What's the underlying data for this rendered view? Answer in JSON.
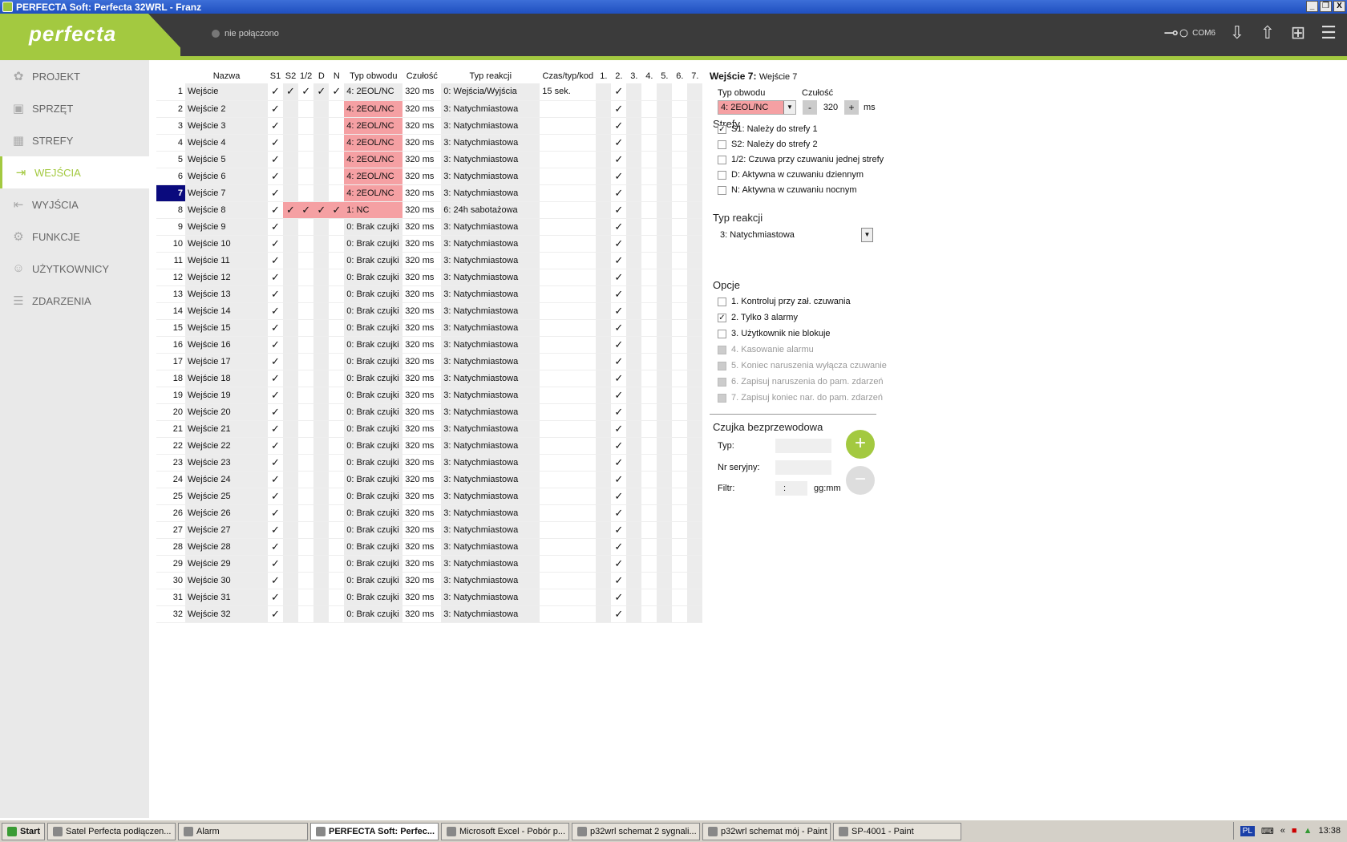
{
  "window": {
    "title": "PERFECTA Soft: Perfecta 32WRL - Franz",
    "buttons": [
      "_",
      "❐",
      "X"
    ]
  },
  "header": {
    "logo": "perfecta",
    "connection_status": "nie połączono",
    "port": "COM6"
  },
  "sidebar": {
    "items": [
      {
        "label": "PROJEKT",
        "icon": "project-icon",
        "active": false
      },
      {
        "label": "SPRZĘT",
        "icon": "chip-icon",
        "active": false
      },
      {
        "label": "STREFY",
        "icon": "zones-icon",
        "active": false
      },
      {
        "label": "WEJŚCIA",
        "icon": "input-icon",
        "active": true
      },
      {
        "label": "WYJŚCIA",
        "icon": "output-icon",
        "active": false
      },
      {
        "label": "FUNKCJE",
        "icon": "gear-icon",
        "active": false
      },
      {
        "label": "UŻYTKOWNICY",
        "icon": "user-icon",
        "active": false
      },
      {
        "label": "ZDARZENIA",
        "icon": "log-icon",
        "active": false
      }
    ]
  },
  "grid": {
    "columns": [
      "Nazwa",
      "S1",
      "S2",
      "1/2",
      "D",
      "N",
      "Typ obwodu",
      "Czułość",
      "Typ reakcji",
      "Czas/typ/kod",
      "1.",
      "2.",
      "3.",
      "4.",
      "5.",
      "6.",
      "7."
    ],
    "check_mark": "✓",
    "rows": [
      {
        "n": "1",
        "name": "Wejście",
        "s1": true,
        "s2": true,
        "half": true,
        "d": true,
        "night": true,
        "typ": "4: 2EOL/NC",
        "czu": "320 ms",
        "rk": "0: Wejścia/Wyjścia",
        "czas": "15 sek.",
        "sel": false,
        "pink": false
      },
      {
        "n": "2",
        "name": "Wejście  2",
        "s1": true,
        "typ": "4: 2EOL/NC",
        "czu": "320 ms",
        "rk": "3: Natychmiastowa",
        "czas": "",
        "pink": true
      },
      {
        "n": "3",
        "name": "Wejście  3",
        "s1": true,
        "typ": "4: 2EOL/NC",
        "czu": "320 ms",
        "rk": "3: Natychmiastowa",
        "czas": "",
        "pink": true
      },
      {
        "n": "4",
        "name": "Wejście  4",
        "s1": true,
        "typ": "4: 2EOL/NC",
        "czu": "320 ms",
        "rk": "3: Natychmiastowa",
        "czas": "",
        "pink": true
      },
      {
        "n": "5",
        "name": "Wejście  5",
        "s1": true,
        "typ": "4: 2EOL/NC",
        "czu": "320 ms",
        "rk": "3: Natychmiastowa",
        "czas": "",
        "pink": true
      },
      {
        "n": "6",
        "name": "Wejście  6",
        "s1": true,
        "typ": "4: 2EOL/NC",
        "czu": "320 ms",
        "rk": "3: Natychmiastowa",
        "czas": "",
        "pink": true
      },
      {
        "n": "7",
        "name": "Wejście  7",
        "s1": true,
        "typ": "4: 2EOL/NC",
        "czu": "320 ms",
        "rk": "3: Natychmiastowa",
        "czas": "",
        "pink": true,
        "sel": true
      },
      {
        "n": "8",
        "name": "Wejście  8",
        "s1": true,
        "s2": true,
        "half": true,
        "d": true,
        "night": true,
        "typ": "1: NC",
        "czu": "320 ms",
        "rk": "6: 24h sabotażowa",
        "czas": "",
        "pink": true,
        "pinkchecks": true
      },
      {
        "n": "9",
        "name": "Wejście  9",
        "s1": true,
        "typ": "0: Brak czujki",
        "czu": "320 ms",
        "rk": "3: Natychmiastowa",
        "czas": ""
      },
      {
        "n": "10",
        "name": "Wejście 10",
        "s1": true,
        "typ": "0: Brak czujki",
        "czu": "320 ms",
        "rk": "3: Natychmiastowa",
        "czas": ""
      },
      {
        "n": "11",
        "name": "Wejście 11",
        "s1": true,
        "typ": "0: Brak czujki",
        "czu": "320 ms",
        "rk": "3: Natychmiastowa",
        "czas": ""
      },
      {
        "n": "12",
        "name": "Wejście 12",
        "s1": true,
        "typ": "0: Brak czujki",
        "czu": "320 ms",
        "rk": "3: Natychmiastowa",
        "czas": ""
      },
      {
        "n": "13",
        "name": "Wejście 13",
        "s1": true,
        "typ": "0: Brak czujki",
        "czu": "320 ms",
        "rk": "3: Natychmiastowa",
        "czas": ""
      },
      {
        "n": "14",
        "name": "Wejście 14",
        "s1": true,
        "typ": "0: Brak czujki",
        "czu": "320 ms",
        "rk": "3: Natychmiastowa",
        "czas": ""
      },
      {
        "n": "15",
        "name": "Wejście 15",
        "s1": true,
        "typ": "0: Brak czujki",
        "czu": "320 ms",
        "rk": "3: Natychmiastowa",
        "czas": ""
      },
      {
        "n": "16",
        "name": "Wejście 16",
        "s1": true,
        "typ": "0: Brak czujki",
        "czu": "320 ms",
        "rk": "3: Natychmiastowa",
        "czas": ""
      },
      {
        "n": "17",
        "name": "Wejście 17",
        "s1": true,
        "typ": "0: Brak czujki",
        "czu": "320 ms",
        "rk": "3: Natychmiastowa",
        "czas": ""
      },
      {
        "n": "18",
        "name": "Wejście 18",
        "s1": true,
        "typ": "0: Brak czujki",
        "czu": "320 ms",
        "rk": "3: Natychmiastowa",
        "czas": ""
      },
      {
        "n": "19",
        "name": "Wejście 19",
        "s1": true,
        "typ": "0: Brak czujki",
        "czu": "320 ms",
        "rk": "3: Natychmiastowa",
        "czas": ""
      },
      {
        "n": "20",
        "name": "Wejście 20",
        "s1": true,
        "typ": "0: Brak czujki",
        "czu": "320 ms",
        "rk": "3: Natychmiastowa",
        "czas": ""
      },
      {
        "n": "21",
        "name": "Wejście 21",
        "s1": true,
        "typ": "0: Brak czujki",
        "czu": "320 ms",
        "rk": "3: Natychmiastowa",
        "czas": ""
      },
      {
        "n": "22",
        "name": "Wejście 22",
        "s1": true,
        "typ": "0: Brak czujki",
        "czu": "320 ms",
        "rk": "3: Natychmiastowa",
        "czas": ""
      },
      {
        "n": "23",
        "name": "Wejście 23",
        "s1": true,
        "typ": "0: Brak czujki",
        "czu": "320 ms",
        "rk": "3: Natychmiastowa",
        "czas": ""
      },
      {
        "n": "24",
        "name": "Wejście 24",
        "s1": true,
        "typ": "0: Brak czujki",
        "czu": "320 ms",
        "rk": "3: Natychmiastowa",
        "czas": ""
      },
      {
        "n": "25",
        "name": "Wejście 25",
        "s1": true,
        "typ": "0: Brak czujki",
        "czu": "320 ms",
        "rk": "3: Natychmiastowa",
        "czas": ""
      },
      {
        "n": "26",
        "name": "Wejście 26",
        "s1": true,
        "typ": "0: Brak czujki",
        "czu": "320 ms",
        "rk": "3: Natychmiastowa",
        "czas": ""
      },
      {
        "n": "27",
        "name": "Wejście 27",
        "s1": true,
        "typ": "0: Brak czujki",
        "czu": "320 ms",
        "rk": "3: Natychmiastowa",
        "czas": ""
      },
      {
        "n": "28",
        "name": "Wejście 28",
        "s1": true,
        "typ": "0: Brak czujki",
        "czu": "320 ms",
        "rk": "3: Natychmiastowa",
        "czas": ""
      },
      {
        "n": "29",
        "name": "Wejście 29",
        "s1": true,
        "typ": "0: Brak czujki",
        "czu": "320 ms",
        "rk": "3: Natychmiastowa",
        "czas": ""
      },
      {
        "n": "30",
        "name": "Wejście 30",
        "s1": true,
        "typ": "0: Brak czujki",
        "czu": "320 ms",
        "rk": "3: Natychmiastowa",
        "czas": ""
      },
      {
        "n": "31",
        "name": "Wejście 31",
        "s1": true,
        "typ": "0: Brak czujki",
        "czu": "320 ms",
        "rk": "3: Natychmiastowa",
        "czas": ""
      },
      {
        "n": "32",
        "name": "Wejście 32",
        "s1": true,
        "typ": "0: Brak czujki",
        "czu": "320 ms",
        "rk": "3: Natychmiastowa",
        "czas": ""
      }
    ]
  },
  "panel": {
    "title": "Wejście 7:",
    "title_name": "Wejście  7",
    "typ_label": "Typ obwodu",
    "typ_value": "4: 2EOL/NC",
    "czulosc_label": "Czułość",
    "czulosc_value": "320",
    "minus": "-",
    "plus": "+",
    "unit": "ms",
    "strefy_label": "Strefy",
    "strefy": [
      {
        "label": "S1: Należy do strefy 1",
        "checked": true
      },
      {
        "label": "S2: Należy do strefy 2",
        "checked": false
      },
      {
        "label": "1/2: Czuwa przy czuwaniu jednej strefy",
        "checked": false
      },
      {
        "label": "D: Aktywna w czuwaniu dziennym",
        "checked": false
      },
      {
        "label": "N: Aktywna w czuwaniu nocnym",
        "checked": false
      }
    ],
    "reakcja_label": "Typ reakcji",
    "reakcja_value": "3: Natychmiastowa",
    "opcje_label": "Opcje",
    "opcje": [
      {
        "label": "1. Kontroluj przy zał. czuwania",
        "checked": false,
        "disabled": false
      },
      {
        "label": "2. Tylko 3 alarmy",
        "checked": true,
        "disabled": false
      },
      {
        "label": "3. Użytkownik nie blokuje",
        "checked": false,
        "disabled": false
      },
      {
        "label": "4. Kasowanie alarmu",
        "checked": false,
        "disabled": true
      },
      {
        "label": "5. Koniec naruszenia wyłącza czuwanie",
        "checked": false,
        "disabled": true
      },
      {
        "label": "6. Zapisuj naruszenia do pam. zdarzeń",
        "checked": false,
        "disabled": true
      },
      {
        "label": "7. Zapisuj koniec nar. do pam. zdarzeń",
        "checked": false,
        "disabled": true
      }
    ],
    "wireless_label": "Czujka bezprzewodowa",
    "typ2_label": "Typ:",
    "serial_label": "Nr seryjny:",
    "filter_label": "Filtr:",
    "filter_value": ":",
    "filter_unit": "gg:mm",
    "add": "+",
    "remove": "−"
  },
  "taskbar": {
    "start": "Start",
    "items": [
      {
        "label": "Satel Perfecta podłączen...",
        "active": false
      },
      {
        "label": "Alarm",
        "active": false
      },
      {
        "label": "PERFECTA Soft: Perfec...",
        "active": true
      },
      {
        "label": "Microsoft Excel - Pobór p...",
        "active": false
      },
      {
        "label": "p32wrl schemat 2 sygnali...",
        "active": false
      },
      {
        "label": "p32wrl schemat mój - Paint",
        "active": false
      },
      {
        "label": "SP-4001 - Paint",
        "active": false
      }
    ],
    "lang": "PL",
    "clock": "13:38"
  },
  "colors": {
    "accent": "#a3c940",
    "header": "#3b3b3b",
    "pink": "#f5a0a3",
    "selected_row": "#0a0a7d"
  }
}
